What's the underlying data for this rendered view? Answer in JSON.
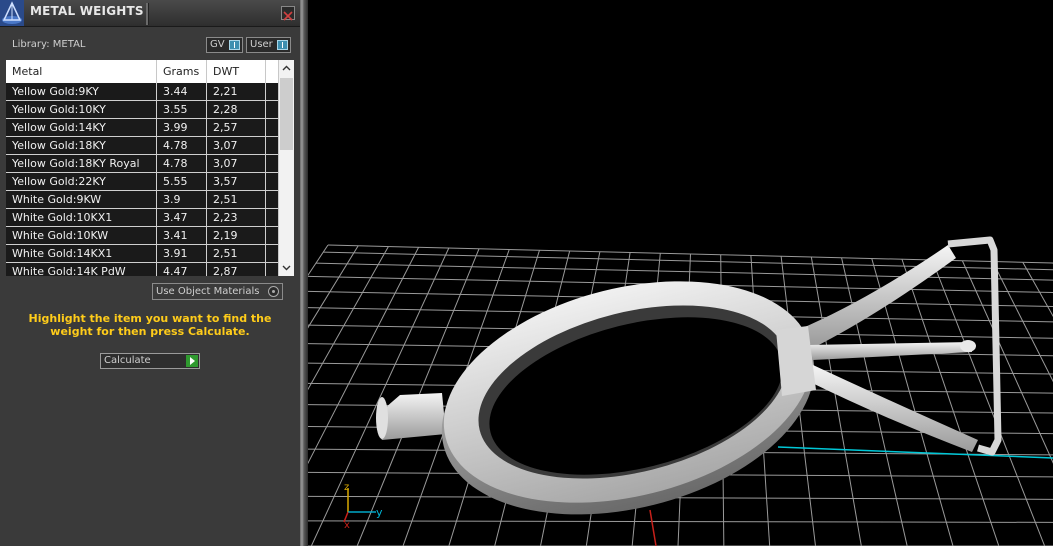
{
  "window": {
    "title": "METAL WEIGHTS",
    "close_glyph": "✕"
  },
  "library": {
    "label": "Library: METAL",
    "toggle_gv": "GV",
    "toggle_user": "User"
  },
  "table": {
    "headers": [
      "Metal",
      "Grams",
      "DWT"
    ],
    "rows": [
      {
        "metal": "Yellow Gold:9KY",
        "grams": "3.44",
        "dwt": "2,21"
      },
      {
        "metal": "Yellow Gold:10KY",
        "grams": "3.55",
        "dwt": "2,28"
      },
      {
        "metal": "Yellow Gold:14KY",
        "grams": "3.99",
        "dwt": "2,57"
      },
      {
        "metal": "Yellow Gold:18KY",
        "grams": "4.78",
        "dwt": "3,07"
      },
      {
        "metal": "Yellow Gold:18KY Royal",
        "grams": "4.78",
        "dwt": "3,07"
      },
      {
        "metal": "Yellow Gold:22KY",
        "grams": "5.55",
        "dwt": "3,57"
      },
      {
        "metal": "White Gold:9KW",
        "grams": "3.9",
        "dwt": "2,51"
      },
      {
        "metal": "White Gold:10KX1",
        "grams": "3.47",
        "dwt": "2,23"
      },
      {
        "metal": "White Gold:10KW",
        "grams": "3.41",
        "dwt": "2,19"
      },
      {
        "metal": "White Gold:14KX1",
        "grams": "3.91",
        "dwt": "2,51"
      },
      {
        "metal": "White Gold:14K PdW",
        "grams": "4.47",
        "dwt": "2,87"
      }
    ]
  },
  "options": {
    "use_object_materials": "Use Object Materials"
  },
  "instructions": "Highlight the item you want to find the weight for then press Calculate.",
  "calculate": {
    "label": "Calculate"
  },
  "viewport": {
    "axis_z": "z",
    "axis_y": "y",
    "axis_x": "x",
    "colors": {
      "grid": "#9a9a9a",
      "axis_y": "#00c8d8",
      "axis_x": "#c8201a",
      "axis_z": "#d8a800",
      "model": "#d0d0d0"
    }
  },
  "icons": {
    "app": "app-logo-icon",
    "close": "close-icon",
    "scroll_up": "chevron-up-icon",
    "scroll_down": "chevron-down-icon",
    "calculate": "play-arrow-icon"
  }
}
